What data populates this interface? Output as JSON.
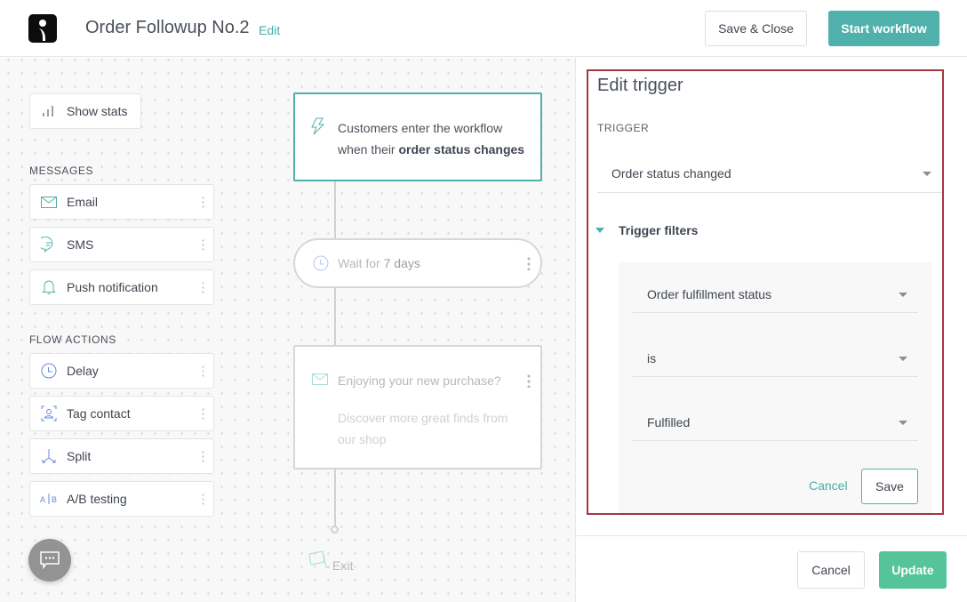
{
  "header": {
    "logo_icon": "brand-logo-icon",
    "title": "Order Followup No.2",
    "edit_label": "Edit",
    "save_close_label": "Save & Close",
    "start_workflow_label": "Start workflow"
  },
  "sidebar": {
    "show_stats_label": "Show stats",
    "messages_heading": "MESSAGES",
    "messages": [
      {
        "label": "Email",
        "icon": "envelope-icon"
      },
      {
        "label": "SMS",
        "icon": "chat-bubble-icon"
      },
      {
        "label": "Push notification",
        "icon": "bell-icon"
      }
    ],
    "flow_actions_heading": "FLOW ACTIONS",
    "flow_actions": [
      {
        "label": "Delay",
        "icon": "clock-icon"
      },
      {
        "label": "Tag contact",
        "icon": "tag-contact-icon"
      },
      {
        "label": "Split",
        "icon": "split-icon"
      },
      {
        "label": "A/B testing",
        "icon": "ab-testing-icon"
      }
    ]
  },
  "flow": {
    "trigger_text": "Customers enter the workflow when their ",
    "trigger_bold": "order status changes",
    "wait_prefix": "Wait for ",
    "wait_value": "7 days",
    "email_subject": "Enjoying your new purchase?",
    "email_body": "Discover more great finds from our shop",
    "exit_label": "Exit"
  },
  "panel": {
    "title": "Edit trigger",
    "trigger_label": "TRIGGER",
    "trigger_value": "Order status changed",
    "filters_label": "Trigger filters",
    "filters": {
      "field": "Order fulfillment status",
      "operator": "is",
      "value": "Fulfilled"
    },
    "filter_cancel_label": "Cancel",
    "filter_save_label": "Save",
    "footer_cancel_label": "Cancel",
    "footer_update_label": "Update"
  },
  "colors": {
    "accent_teal": "#50b0ac",
    "update_green": "#56c49a",
    "highlight_red": "#a2393f"
  }
}
